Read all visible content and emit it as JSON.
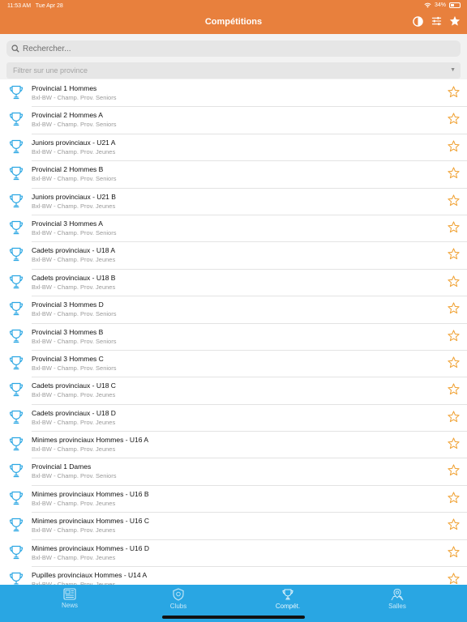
{
  "status_bar": {
    "time": "11:53 AM",
    "date": "Tue Apr 28",
    "battery": "34%"
  },
  "nav": {
    "title": "Compétitions"
  },
  "search": {
    "placeholder": "Rechercher..."
  },
  "filter": {
    "placeholder": "Filtrer sur une province"
  },
  "competitions": [
    {
      "title": "Provincial 1 Hommes",
      "subtitle": "Bxl-BW - Champ. Prov. Seniors"
    },
    {
      "title": "Provincial 2 Hommes A",
      "subtitle": "Bxl-BW - Champ. Prov. Seniors"
    },
    {
      "title": "Juniors provinciaux - U21 A",
      "subtitle": "Bxl-BW - Champ. Prov. Jeunes"
    },
    {
      "title": "Provincial 2 Hommes B",
      "subtitle": "Bxl-BW - Champ. Prov. Seniors"
    },
    {
      "title": "Juniors provinciaux - U21 B",
      "subtitle": "Bxl-BW - Champ. Prov. Jeunes"
    },
    {
      "title": "Provincial 3 Hommes A",
      "subtitle": "Bxl-BW - Champ. Prov. Seniors"
    },
    {
      "title": "Cadets provinciaux - U18 A",
      "subtitle": "Bxl-BW - Champ. Prov. Jeunes"
    },
    {
      "title": "Cadets provinciaux - U18 B",
      "subtitle": "Bxl-BW - Champ. Prov. Jeunes"
    },
    {
      "title": "Provincial 3 Hommes D",
      "subtitle": "Bxl-BW - Champ. Prov. Seniors"
    },
    {
      "title": "Provincial 3 Hommes B",
      "subtitle": "Bxl-BW - Champ. Prov. Seniors"
    },
    {
      "title": "Provincial 3 Hommes C",
      "subtitle": "Bxl-BW - Champ. Prov. Seniors"
    },
    {
      "title": "Cadets provinciaux - U18 C",
      "subtitle": "Bxl-BW - Champ. Prov. Jeunes"
    },
    {
      "title": "Cadets provinciaux - U18 D",
      "subtitle": "Bxl-BW - Champ. Prov. Jeunes"
    },
    {
      "title": "Minimes provinciaux Hommes - U16 A",
      "subtitle": "Bxl-BW - Champ. Prov. Jeunes"
    },
    {
      "title": "Provincial 1 Dames",
      "subtitle": "Bxl-BW - Champ. Prov. Seniors"
    },
    {
      "title": "Minimes provinciaux Hommes - U16 B",
      "subtitle": "Bxl-BW - Champ. Prov. Jeunes"
    },
    {
      "title": "Minimes provinciaux Hommes - U16 C",
      "subtitle": "Bxl-BW - Champ. Prov. Jeunes"
    },
    {
      "title": "Minimes provinciaux Hommes - U16 D",
      "subtitle": "Bxl-BW - Champ. Prov. Jeunes"
    },
    {
      "title": "Pupilles provinciaux Hommes - U14 A",
      "subtitle": "Bxl-BW - Champ. Prov. Jeunes"
    }
  ],
  "tabs": [
    {
      "label": "News",
      "icon": "news-icon"
    },
    {
      "label": "Clubs",
      "icon": "shield-icon"
    },
    {
      "label": "Compét.",
      "icon": "trophy-icon"
    },
    {
      "label": "Salles",
      "icon": "location-icon"
    }
  ],
  "colors": {
    "header": "#e8803d",
    "tabbar": "#29a6e3",
    "trophy": "#29a6e3",
    "star": "#f0a030"
  }
}
